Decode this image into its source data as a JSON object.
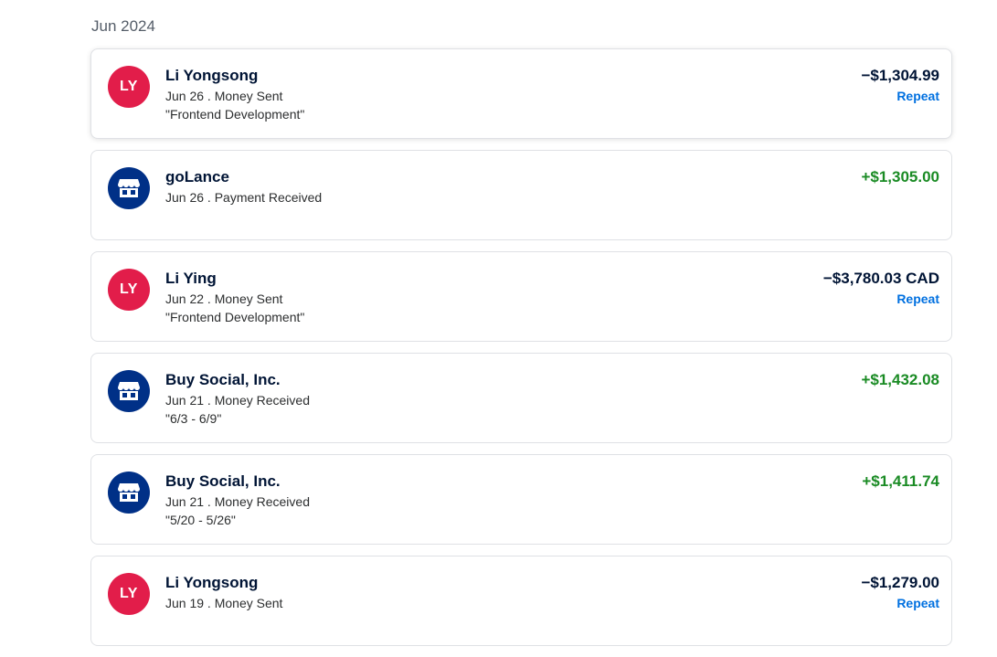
{
  "section": {
    "title": "Jun 2024"
  },
  "transactions": [
    {
      "avatar_type": "initials",
      "initials": "LY",
      "name": "Li Yongsong",
      "meta": "Jun 26 . Money Sent",
      "note": "\"Frontend Development\"",
      "amount": "−$1,304.99",
      "direction": "out",
      "repeat": "Repeat"
    },
    {
      "avatar_type": "merchant",
      "icon": "store-icon",
      "name": "goLance",
      "meta": "Jun 26 . Payment Received",
      "amount": "+$1,305.00",
      "direction": "in"
    },
    {
      "avatar_type": "initials",
      "initials": "LY",
      "name": "Li Ying",
      "meta": "Jun 22 . Money Sent",
      "note": "\"Frontend Development\"",
      "amount": "−$3,780.03 CAD",
      "direction": "out",
      "repeat": "Repeat"
    },
    {
      "avatar_type": "merchant",
      "icon": "store-icon",
      "name": "Buy Social, Inc.",
      "meta": "Jun 21 . Money Received",
      "note": "\"6/3 - 6/9\"",
      "amount": "+$1,432.08",
      "direction": "in"
    },
    {
      "avatar_type": "merchant",
      "icon": "store-icon",
      "name": "Buy Social, Inc.",
      "meta": "Jun 21 . Money Received",
      "note": "\"5/20 - 5/26\"",
      "amount": "+$1,411.74",
      "direction": "in"
    },
    {
      "avatar_type": "initials",
      "initials": "LY",
      "name": "Li Yongsong",
      "meta": "Jun 19 . Money Sent",
      "amount": "−$1,279.00",
      "direction": "out",
      "repeat": "Repeat"
    }
  ],
  "colors": {
    "sent_avatar": "#e21d4a",
    "merchant_avatar": "#003087",
    "incoming_amount": "#1a8b24",
    "link": "#0070e0"
  }
}
